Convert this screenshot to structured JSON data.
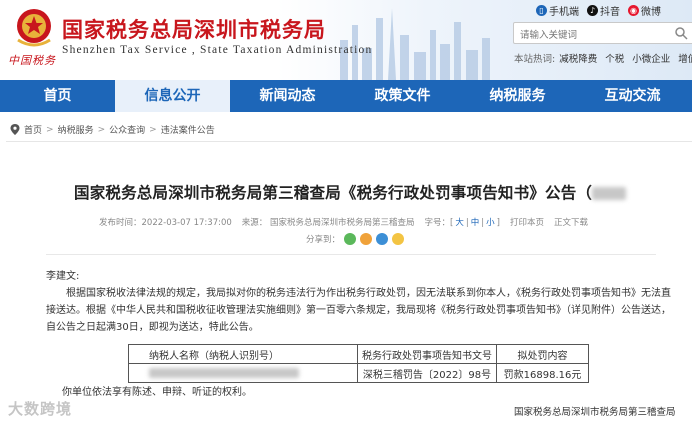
{
  "header": {
    "site_title": "国家税务总局深圳市税务局",
    "site_subtitle": "Shenzhen  Tax  Service , State Taxation  Administration",
    "logo_text": "中国税务",
    "top_links": [
      {
        "label": "手机端",
        "icon": "mobile-icon",
        "color": "#1d66b8"
      },
      {
        "label": "抖音",
        "icon": "douyin-icon",
        "color": "#111111"
      },
      {
        "label": "微博",
        "icon": "weibo-icon",
        "color": "#e6162d"
      }
    ],
    "search_placeholder": "请输入关键词",
    "hot_label": "本站热词:",
    "hot_words": [
      "减税降费",
      "个税",
      "小微企业",
      "增值税"
    ]
  },
  "nav": {
    "items": [
      "首页",
      "信息公开",
      "新闻动态",
      "政策文件",
      "纳税服务",
      "互动交流"
    ],
    "active_index": 1,
    "bar_color": "#1d66b8"
  },
  "breadcrumb": [
    "首页",
    "纳税服务",
    "公众查询",
    "违法案件公告"
  ],
  "article": {
    "title": "国家税务总局深圳市税务局第三稽查局《税务行政处罚事项告知书》公告（",
    "meta": {
      "published": "发布时间：2022-03-07 17:37:00",
      "source": "来源：  国家税务总局深圳市税务局第三稽查局",
      "font_label": "字号：",
      "font_big": "大",
      "font_mid": "中",
      "font_small": "小",
      "print": "打印本页",
      "close": "正文下载"
    },
    "share_label": "分享到：",
    "greeting": "李建文:",
    "paragraph1": "根据国家税收法律法规的规定，我局拟对你的税务违法行为作出税务行政处罚，因无法联系到你本人，《税务行政处罚事项告知书》无法直接送达。根据《中华人民共和国税收征收管理法实施细则》第一百零六条规定，我局现将《税务行政处罚事项告知书》（详见附件）公告送达，自公告之日起满30日，即视为送达，特此公告。",
    "table": {
      "headers": [
        "纳税人名称（纳税人识别号）",
        "税务行政处罚事项告知书文号",
        "拟处罚内容"
      ],
      "rows": [
        [
          "",
          "深税三稽罚告〔2022〕98号",
          "罚款16898.16元"
        ]
      ]
    },
    "closing": "你单位依法享有陈述、申辩、听证的权利。",
    "signature": "国家税务总局深圳市税务局第三稽查局"
  },
  "watermark": "大数跨境"
}
